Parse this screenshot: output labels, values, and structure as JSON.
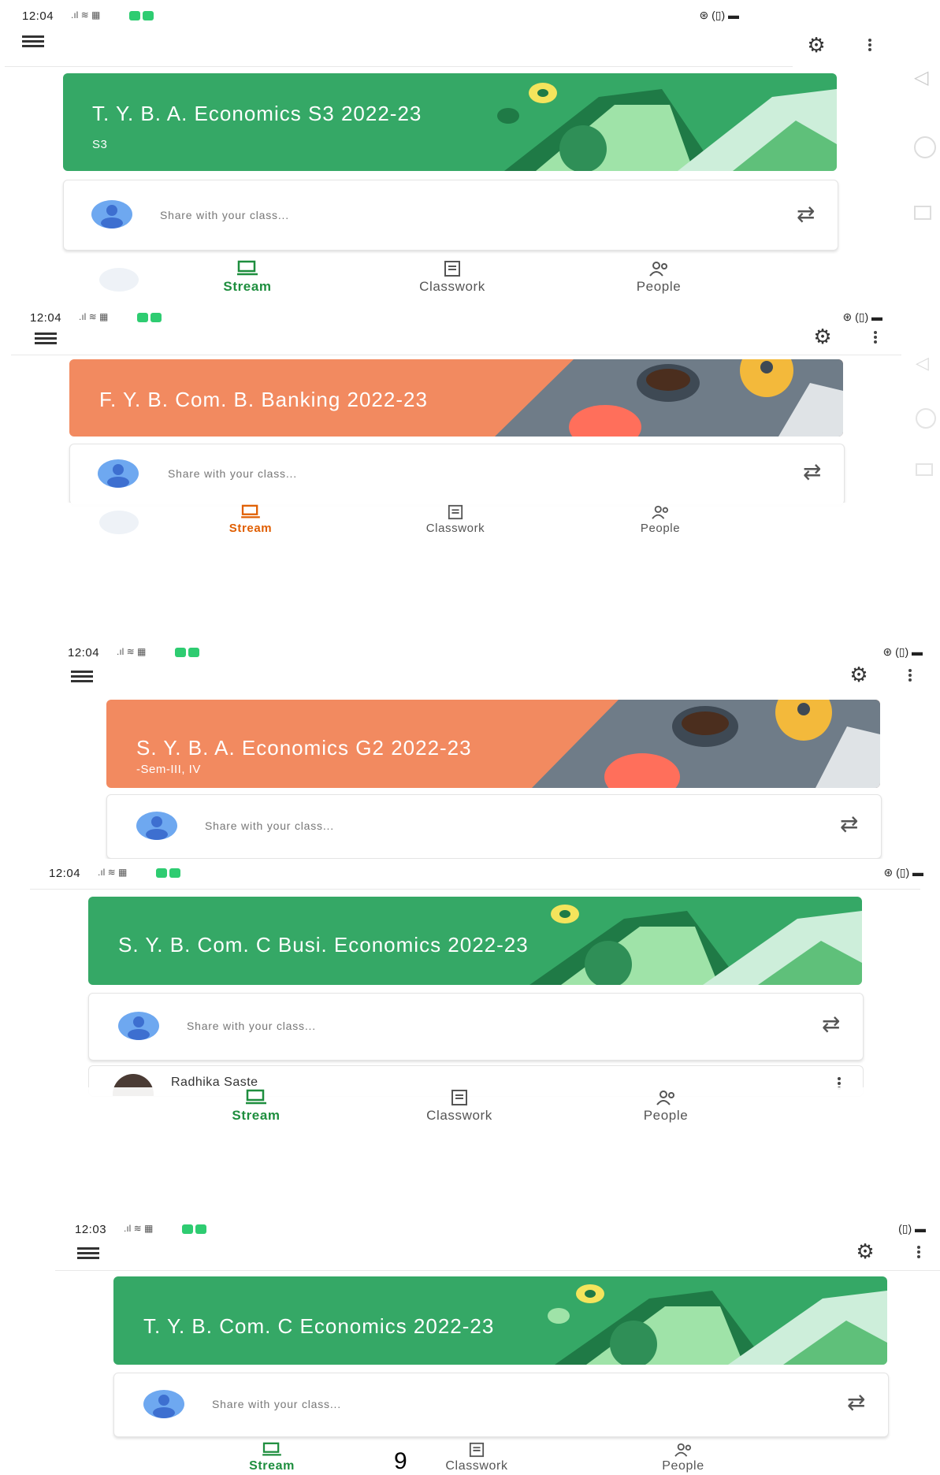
{
  "common": {
    "share_placeholder": "Share with your class...",
    "nav": {
      "stream": "Stream",
      "classwork": "Classwork",
      "people": "People"
    }
  },
  "colors": {
    "green_banner": "#35a866",
    "orange_banner": "#f28a60",
    "active_nav": "#1e8e3e"
  },
  "screens": [
    {
      "time": "12:04",
      "title": "T. Y. B. A. Economics S3  2022-23",
      "subtitle": "S3",
      "theme": "green"
    },
    {
      "time": "12:04",
      "title": "F. Y. B. Com.  B. Banking  2022-23",
      "subtitle": "",
      "theme": "orange"
    },
    {
      "time": "12:04",
      "title": "S. Y. B. A. Economics G2  2022-23",
      "subtitle": "-Sem-III, IV",
      "theme": "orange"
    },
    {
      "time": "12:04",
      "title": "S. Y. B. Com.  C   Busi. Economics 2022-23",
      "subtitle": "",
      "theme": "green",
      "person": "Radhika Saste"
    },
    {
      "time": "12:03",
      "title": "T. Y. B. Com. C Economics 2022-23",
      "subtitle": "",
      "theme": "green"
    }
  ],
  "page_number": "9"
}
